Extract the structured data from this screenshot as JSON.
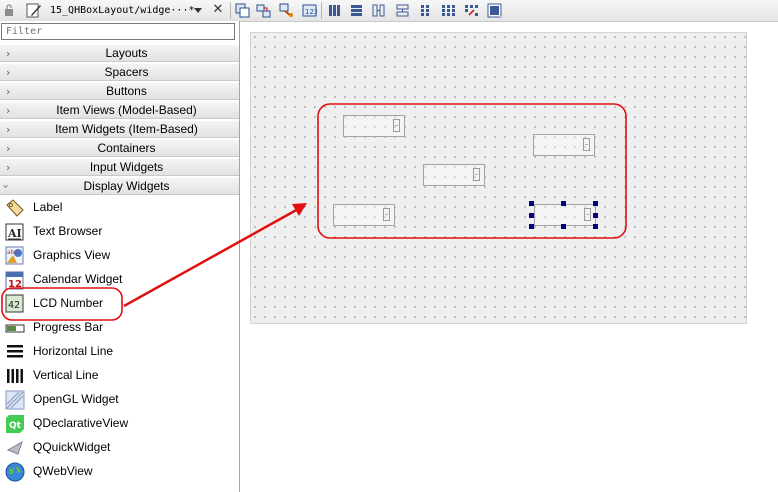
{
  "toolbar": {
    "file_title": "15_QHBoxLayout/widge···*",
    "icons": [
      "lock-icon",
      "edit-icon",
      "dropdown-icon",
      "close-icon",
      "edit-widgets-icon",
      "edit-signals-slots-icon",
      "edit-buddies-icon",
      "edit-tab-order-icon",
      "lay-out-horizontally-icon",
      "lay-out-vertically-icon",
      "lay-out-horizontal-splitter-icon",
      "lay-out-vertical-splitter-icon",
      "lay-out-form-icon",
      "lay-out-grid-icon",
      "break-layout-icon",
      "adjust-size-icon"
    ]
  },
  "widgetbox": {
    "filter_placeholder": "Filter",
    "categories": [
      {
        "label": "Layouts",
        "expanded": false
      },
      {
        "label": "Spacers",
        "expanded": false
      },
      {
        "label": "Buttons",
        "expanded": false
      },
      {
        "label": "Item Views (Model-Based)",
        "expanded": false
      },
      {
        "label": "Item Widgets (Item-Based)",
        "expanded": false
      },
      {
        "label": "Containers",
        "expanded": false
      },
      {
        "label": "Input Widgets",
        "expanded": false
      },
      {
        "label": "Display Widgets",
        "expanded": true
      }
    ],
    "display_widgets": [
      {
        "label": "Label",
        "icon": "label-icon"
      },
      {
        "label": "Text Browser",
        "icon": "text-browser-icon"
      },
      {
        "label": "Graphics View",
        "icon": "graphics-view-icon"
      },
      {
        "label": "Calendar Widget",
        "icon": "calendar-icon",
        "icon_text": "12"
      },
      {
        "label": "LCD Number",
        "icon": "lcd-number-icon",
        "icon_text": "42",
        "highlighted": true
      },
      {
        "label": "Progress Bar",
        "icon": "progress-bar-icon"
      },
      {
        "label": "Horizontal Line",
        "icon": "horizontal-line-icon"
      },
      {
        "label": "Vertical Line",
        "icon": "vertical-line-icon"
      },
      {
        "label": "OpenGL Widget",
        "icon": "opengl-widget-icon"
      },
      {
        "label": "QDeclarativeView",
        "icon": "qt-logo-icon",
        "icon_text": "Qt"
      },
      {
        "label": "QQuickWidget",
        "icon": "qquickwidget-icon"
      },
      {
        "label": "QWebView",
        "icon": "globe-icon"
      }
    ]
  },
  "form": {
    "lcd_widgets": 5,
    "selected_lcd": 5
  },
  "colors": {
    "annotation_red": "#e01010",
    "selection_handle": "#000080",
    "form_background": "#efefef"
  }
}
